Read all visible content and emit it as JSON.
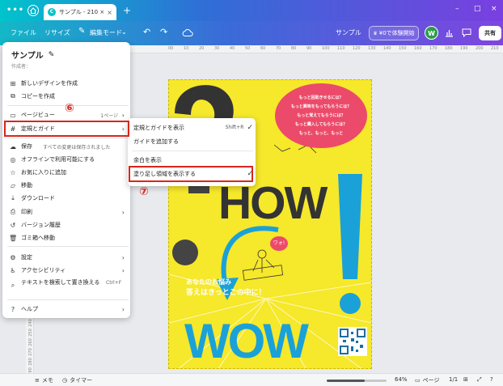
{
  "titlebar": {
    "tab_label": "サンプル - 210 × 297...",
    "tab_close": "×",
    "new_tab": "+",
    "window_controls": [
      "–",
      "□",
      "×"
    ]
  },
  "toolbar": {
    "file": "ファイル",
    "resize": "リサイズ",
    "edit_mode": "編集モード",
    "design_name": "サンプル",
    "trial_label": "¥0で体験開始",
    "avatar_initial": "W",
    "share_label": "共有"
  },
  "rulers": {
    "top": [
      "00",
      "10",
      "20",
      "30",
      "40",
      "50",
      "60",
      "70",
      "80",
      "90",
      "100",
      "110",
      "120",
      "130",
      "140",
      "150",
      "160",
      "170",
      "180",
      "190",
      "200",
      "210"
    ],
    "left": [
      "240",
      "250",
      "260",
      "270",
      "280",
      "290"
    ]
  },
  "menu": {
    "title": "サンプル",
    "author_label": "作成者：",
    "items": {
      "new_design": "新しいデザインを作成",
      "make_copy": "コピーを作成",
      "page_view": "ページビュー",
      "page_view_extra": "1ページ",
      "rulers_guides": "定規とガイド",
      "save": "保存",
      "save_status": "すべての変更は保存されました",
      "offline": "オフラインで利用可能にする",
      "favorite": "お気に入りに追加",
      "move": "移動",
      "download": "ダウンロード",
      "print": "印刷",
      "version_history": "バージョン履歴",
      "trash": "ゴミ箱へ移動",
      "settings": "設定",
      "accessibility": "アクセシビリティ",
      "find_replace": "テキストを検索して置き換える",
      "find_replace_shortcut": "Ctrl+F",
      "help": "ヘルプ"
    }
  },
  "submenu": {
    "show_rulers": "定規とガイドを表示",
    "show_rulers_shortcut": "Shift+R",
    "add_guides": "ガイドを追加する",
    "show_margins": "余白を表示",
    "show_bleed": "塗り足し領域を表示する"
  },
  "annotations": {
    "step6": "⑥",
    "step7": "⑦",
    "color": "#d9261c"
  },
  "poster": {
    "bubble_lines": [
      "もっと回助きせるには？",
      "もっと興味をもってもらうには？",
      "もっと覚えてもらうには？",
      "もっと購入してもらうには？",
      "もっと、もっと、もっと"
    ],
    "how": "HOW",
    "wao": "ワォ!",
    "worry_line1": "あなたのお悩み",
    "worry_line2": "答えはきっとこの中に！",
    "wow": "WOW",
    "background_color": "#f6e82a",
    "accent_pink": "#ec4a6a",
    "accent_blue": "#1aa1d8"
  },
  "statusbar": {
    "memo": "メモ",
    "timer": "タイマー",
    "zoom": "64%",
    "zoom_fraction": 0.64,
    "pages_label": "ページ",
    "page_counter": "1/1"
  }
}
